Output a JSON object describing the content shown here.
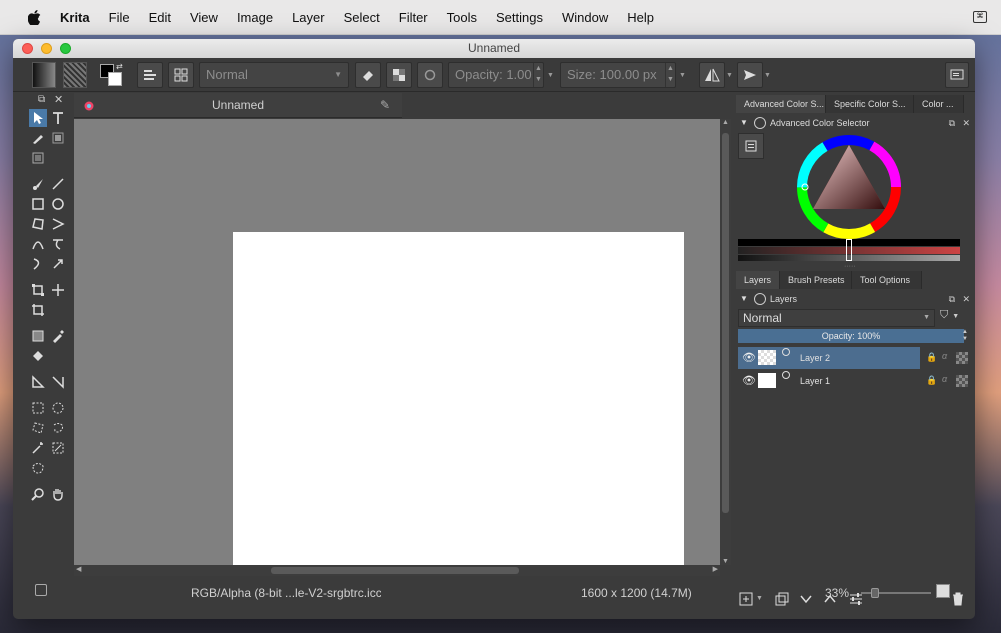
{
  "menubar": {
    "app": "Krita",
    "items": [
      "File",
      "Edit",
      "View",
      "Image",
      "Layer",
      "Select",
      "Filter",
      "Tools",
      "Settings",
      "Window",
      "Help"
    ]
  },
  "window": {
    "title": "Unnamed"
  },
  "toolbar": {
    "blend_mode": "Normal",
    "opacity_label": "Opacity:",
    "opacity_value": "1.00",
    "size_label": "Size:",
    "size_value": "100.00 px"
  },
  "document": {
    "tab_title": "Unnamed"
  },
  "status": {
    "color_profile": "RGB/Alpha (8-bit ...le-V2-srgbtrc.icc",
    "dimensions": "1600 x 1200 (14.7M)",
    "zoom": "33%"
  },
  "docker_top": {
    "tabs": [
      "Advanced Color S...",
      "Specific Color S...",
      "Color ..."
    ],
    "panel_title": "Advanced Color Selector"
  },
  "docker_bottom": {
    "tabs": [
      "Layers",
      "Brush Presets",
      "Tool Options"
    ],
    "panel_title": "Layers",
    "blend_mode": "Normal",
    "opacity": "Opacity:  100%",
    "layers": [
      {
        "name": "Layer 2",
        "selected": true
      },
      {
        "name": "Layer 1",
        "selected": false
      }
    ]
  },
  "colors": {
    "accent": "#4c6d8f",
    "canvas_bg": "#808080",
    "ui_bg": "#3b3b3b"
  }
}
